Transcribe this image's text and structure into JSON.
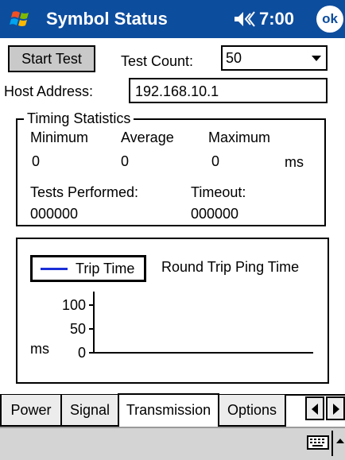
{
  "title_bar": {
    "app_title": "Symbol Status",
    "time": "7:00",
    "ok_label": "ok",
    "icons": [
      "windows-start-icon",
      "speaker-icon"
    ]
  },
  "controls": {
    "start_test_label": "Start Test",
    "test_count_label": "Test Count:",
    "test_count_value": "50",
    "host_address_label": "Host Address:",
    "host_address_value": "192.168.10.1"
  },
  "timing": {
    "group_label": "Timing Statistics",
    "minimum_label": "Minimum",
    "average_label": "Average",
    "maximum_label": "Maximum",
    "minimum_value": "0",
    "average_value": "0",
    "maximum_value": "0",
    "unit": "ms",
    "tests_performed_label": "Tests Performed:",
    "tests_performed_value": "000000",
    "timeout_label": "Timeout:",
    "timeout_value": "000000"
  },
  "chart": {
    "title": "Round Trip Ping Time",
    "legend_label": "Trip Time",
    "series_color": "#1a2ed8",
    "y_unit": "ms",
    "y_ticks": [
      "100",
      "50",
      "0"
    ]
  },
  "tabs": [
    "Power",
    "Signal",
    "Transmission",
    "Options"
  ],
  "active_tab": "Transmission",
  "colors": {
    "title_bar": "#0d4d9e",
    "bottom_bar": "#d4d4d4"
  },
  "chart_data": {
    "type": "line",
    "title": "Round Trip Ping Time",
    "ylabel": "ms",
    "ylim": [
      0,
      100
    ],
    "yticks": [
      0,
      50,
      100
    ],
    "series": [
      {
        "name": "Trip Time",
        "values": []
      }
    ],
    "legend": "top-left",
    "grid": false
  }
}
